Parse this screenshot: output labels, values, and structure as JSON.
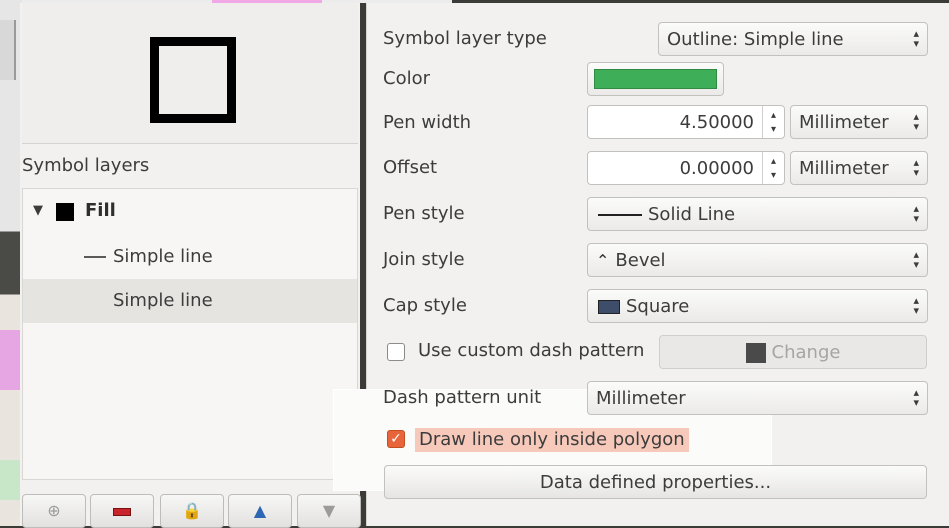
{
  "left": {
    "symbol_layers_label": "Symbol layers",
    "tree": [
      {
        "label": "Fill",
        "kind": "fill"
      },
      {
        "label": "Simple line",
        "kind": "line"
      },
      {
        "label": "Simple line",
        "kind": "line",
        "selected": true
      }
    ],
    "tree_toggle_glyph": "▼",
    "tools": [
      "add-icon",
      "remove-icon",
      "lock-icon",
      "move-up-icon",
      "move-down-icon"
    ]
  },
  "right": {
    "symbol_layer_type_label": "Symbol layer type",
    "symbol_layer_type_value": "Outline: Simple line",
    "color_label": "Color",
    "color_value": "#3fae58",
    "pen_width_label": "Pen width",
    "pen_width_value": "4.50000",
    "pen_width_unit": "Millimeter",
    "offset_label": "Offset",
    "offset_value": "0.00000",
    "offset_unit": "Millimeter",
    "pen_style_label": "Pen style",
    "pen_style_value": "Solid Line",
    "join_style_label": "Join style",
    "join_style_value": "Bevel",
    "cap_style_label": "Cap style",
    "cap_style_value": "Square",
    "custom_dash_label": "Use custom dash pattern",
    "custom_dash_checked": false,
    "change_label": "Change",
    "dash_unit_label": "Dash pattern unit",
    "dash_unit_value": "Millimeter",
    "draw_inside_label": "Draw line only inside polygon",
    "draw_inside_checked": true,
    "data_defined_label": "Data defined properties..."
  }
}
